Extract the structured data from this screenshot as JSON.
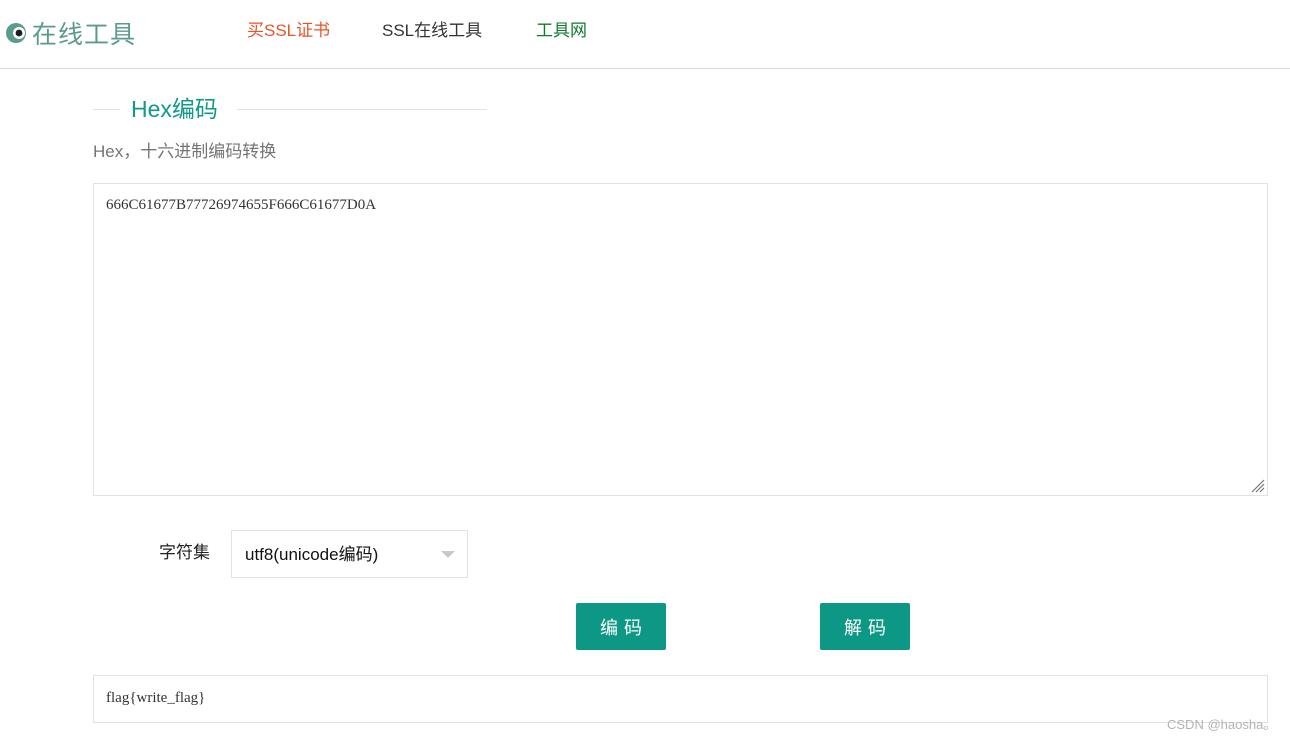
{
  "header": {
    "logo_text": "在线工具",
    "nav": [
      {
        "label": "买SSL证书",
        "color": "#e8542a"
      },
      {
        "label": "SSL在线工具",
        "color": "#333333"
      },
      {
        "label": "工具网",
        "color": "#0f7a2e"
      }
    ]
  },
  "tool": {
    "title": "Hex编码",
    "subtitle": "Hex，十六进制编码转换",
    "input_value": "666C61677B77726974655F666C61677D0A",
    "charset_label": "字符集",
    "charset_selected": "utf8(unicode编码)",
    "encode_label": "编码",
    "decode_label": "解码",
    "output_value": "flag{write_flag}"
  },
  "watermark": "CSDN @haosha。",
  "colors": {
    "accent": "#0d9785",
    "title": "#11998a",
    "logo": "#5b9a8f"
  },
  "icons": {
    "logo": "logo-icon",
    "dropdown": "chevron-down-icon",
    "resize": "resize-grip-icon"
  }
}
